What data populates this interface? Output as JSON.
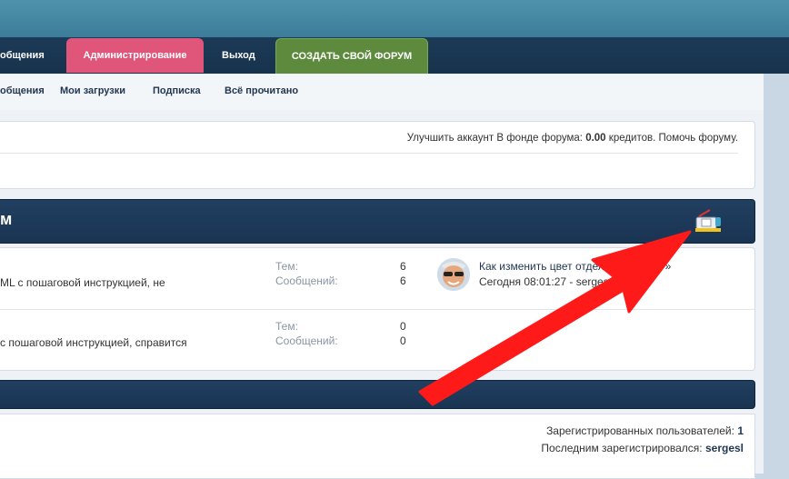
{
  "nav": {
    "messages": "общения",
    "admin": "Администрирование",
    "logout": "Выход",
    "create_forum": "СОЗДАТЬ СВОЙ ФОРУМ"
  },
  "subnav": {
    "messages": "общения",
    "my_uploads": "Мои загрузки",
    "subscription": "Подписка",
    "all_read": "Всё прочитано"
  },
  "info": {
    "upgrade": "Улучшить аккаунт",
    "fund_label": "В фонде форума:",
    "fund_value": "0.00",
    "credits": "кредитов.",
    "help": "Помочь форуму."
  },
  "category": {
    "title": "м",
    "icon": "rss-feed-icon"
  },
  "forums": [
    {
      "desc": "ML с пошаговой инструкцией, не",
      "topics_label": "Тем:",
      "topics": "6",
      "posts_label": "Сообщений:",
      "posts": "6",
      "last_post_title": "Как изменить цвет отдельных (CSS) »",
      "last_post_meta": "Сегодня 08:01:27 - serges"
    },
    {
      "desc": "с пошаговой инструкцией, справится",
      "topics_label": "Тем:",
      "topics": "0",
      "posts_label": "Сообщений:",
      "posts": "0"
    }
  ],
  "stats": {
    "registered_label": "Зарегистрированных пользователей:",
    "registered_value": "1",
    "last_registered_label": "Последним зарегистрировался:",
    "last_registered_value": "sergesl"
  },
  "colors": {
    "arrow": "#ff1a1a",
    "accent": "#e0567a",
    "create": "#5d8a3c"
  }
}
